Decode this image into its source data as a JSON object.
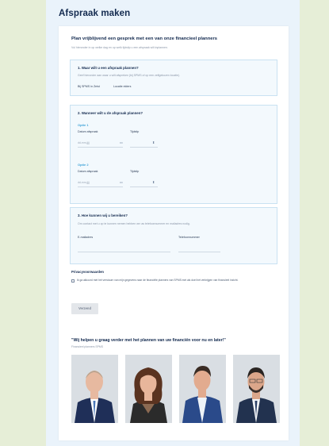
{
  "page": {
    "title": "Afspraak maken"
  },
  "form": {
    "heading": "Plan vrijblijvend een gesprek met een van onze financieel planners",
    "subheading": "Vul hieronder in op welke dag en op welk tijdstip u een afspraak wilt inplannen.",
    "where": {
      "title": "1. Waar wilt u een afspraak plannen?",
      "hint": "Geef hieronder aan waar u wilt afspreken (bij SPMS of op een zelfgekozen locatie).",
      "options": [
        "Bij SPMS in Zeist",
        "Locatie elders"
      ]
    },
    "when": {
      "title": "2. Wanneer wilt u de afspraak plannen?",
      "option1": "Optie 1",
      "option2": "Optie 2",
      "date_label": "Datum afspraak",
      "time_label": "Tijdstip",
      "date_placeholder": "dd-mm-jjjj"
    },
    "contact": {
      "title": "3. Hoe kunnen wij u bereiken?",
      "hint": "Om contact met u op te kunnen nemen hebben we uw telefoonnummer en mailadres nodig.",
      "email_label": "E-mailadres",
      "phone_label": "Telefoonnummer"
    },
    "privacy": {
      "title": "Privacyvoorwaarden",
      "text": "Ik ga akkoord met het verstuurn van mijn gegevens naar de financiële planners van SPMS met als doel het verkrijgen van financieel inzicht."
    },
    "submit_label": "Verzend"
  },
  "testimonial": {
    "quote": "\"Wij helpen u graag verder met het plannen van uw financiën voor nu en later!\"",
    "attribution": "Financieel planners SPMS"
  },
  "planners": [
    {
      "name": "planner-1",
      "tie_color": "#4a77b8",
      "hair_color": "#b9a38f",
      "skin": "#e7b9a0"
    },
    {
      "name": "planner-2",
      "tie_color": "#2b2b2b",
      "hair_color": "#5a3320",
      "skin": "#e8b69b"
    },
    {
      "name": "planner-3",
      "tie_color": "#1f3c78",
      "hair_color": "#3a2c24",
      "skin": "#e2ab8f"
    },
    {
      "name": "planner-4",
      "tie_color": "#2a3f66",
      "hair_color": "#2a2522",
      "skin": "#dba68a"
    }
  ]
}
